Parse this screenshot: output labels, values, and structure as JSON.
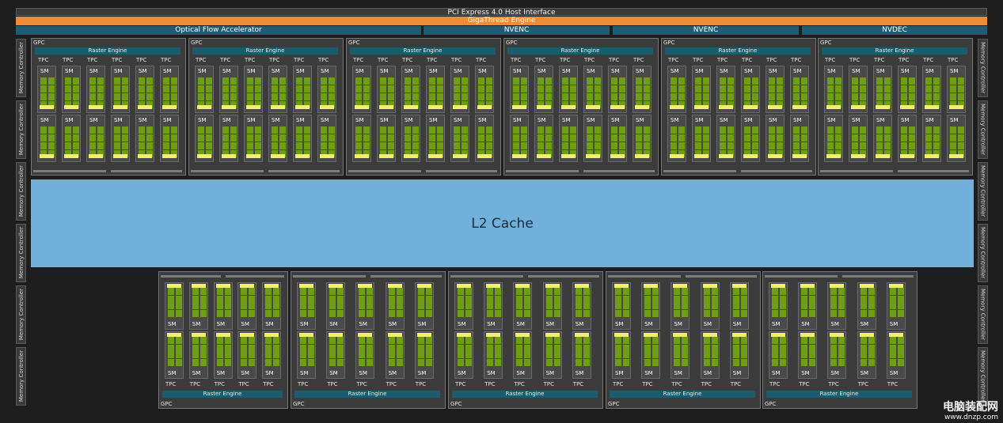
{
  "top": {
    "pcie": "PCI Express 4.0 Host Interface",
    "gigathread": "GigaThread Engine",
    "ofa": "Optical Flow Accelerator",
    "nvenc1": "NVENC",
    "nvenc2": "NVENC",
    "nvdec": "NVDEC"
  },
  "memory_controller": "Memory Controller",
  "l2": "L2 Cache",
  "gpc_label": "GPC",
  "raster_engine": "Raster Engine",
  "tpc_label": "TPC",
  "sm_label": "SM",
  "watermark": {
    "cn": "电脑装配网",
    "url": "www.dnzp.com"
  },
  "colors": {
    "gigathread": "#ef8a35",
    "l2": "#72b0dc",
    "raster": "#1d5c6e",
    "sm_green": "#6e9e12",
    "sm_yellow": "#f0f06c"
  }
}
